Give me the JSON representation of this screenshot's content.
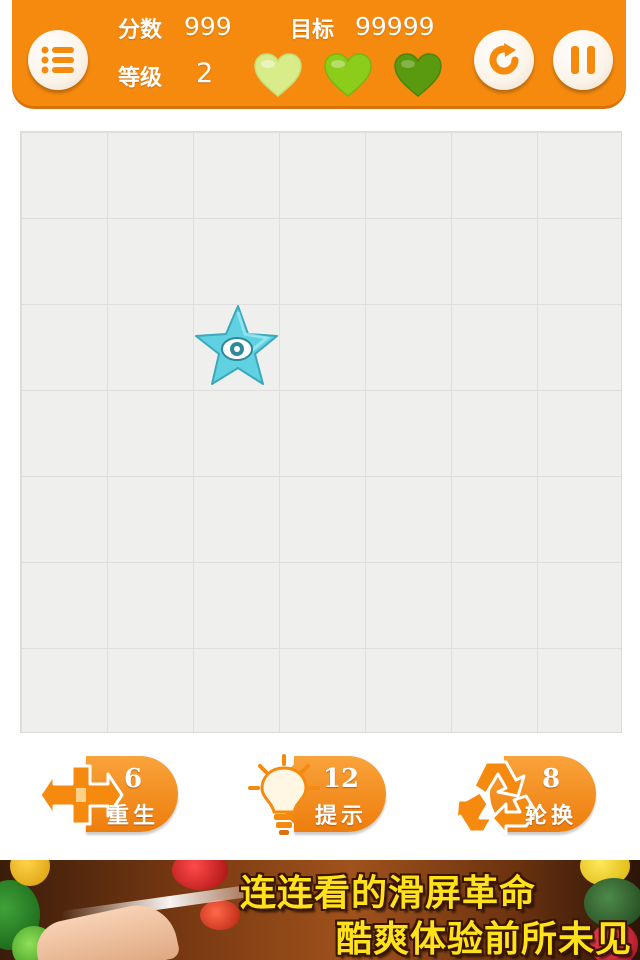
{
  "header": {
    "score_label": "分数",
    "score_value": "999",
    "target_label": "目标",
    "target_value": "99999",
    "level_label": "等级",
    "level_value": "2",
    "menu_icon": "list-icon",
    "refresh_icon": "refresh-icon",
    "pause_icon": "pause-icon",
    "hearts": [
      {
        "icon": "heart-icon",
        "color": "#d9ec8a"
      },
      {
        "icon": "heart-icon",
        "color": "#8ccc1a"
      },
      {
        "icon": "heart-icon",
        "color": "#5a9a0e"
      }
    ],
    "accent_color": "#f58a0f"
  },
  "board": {
    "rows": 7,
    "cols": 7,
    "tiles": [
      {
        "row": 2,
        "col": 2,
        "icon": "cyan-star-monster-icon",
        "color": "#5fd1e0"
      }
    ]
  },
  "actions": {
    "revive": {
      "count": "6",
      "label": "重生",
      "icon": "cross-arrows-icon"
    },
    "hint": {
      "count": "12",
      "label": "提示",
      "icon": "lightbulb-icon"
    },
    "shuffle": {
      "count": "8",
      "label": "轮换",
      "icon": "recycle-icon"
    }
  },
  "banner": {
    "line1": "连连看的滑屏革命",
    "line2": "酷爽体验前所未见"
  }
}
